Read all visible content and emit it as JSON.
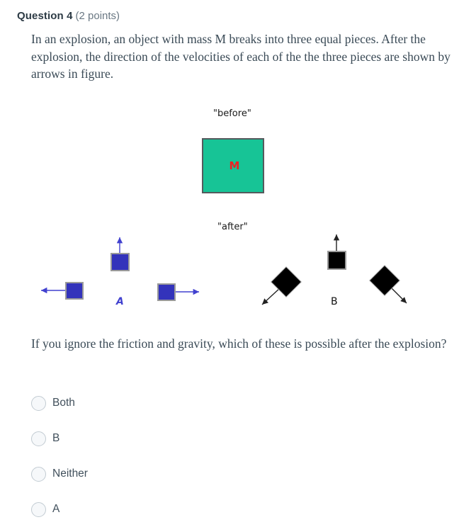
{
  "header": {
    "question_title": "Question 4",
    "points": "(2 points)"
  },
  "stem": {
    "text": "In an explosion, an object with mass M breaks into three equal pieces. After the explosion, the direction of the velocities of each of the the three pieces are shown by arrows in figure."
  },
  "figure": {
    "before_label": "\"before\"",
    "after_label": "\"after\"",
    "mass_label": "M",
    "diagram_a_letter": "A",
    "diagram_b_letter": "B",
    "colors": {
      "before_box_fill": "#17c496",
      "before_box_border": "#555a5d",
      "mass_text": "#ee2222",
      "diagram_a_square_fill": "#3333bb",
      "diagram_a_square_border": "#9a9a9a",
      "diagram_a_arrow": "#4141cf",
      "diagram_b_square_fill": "#000000",
      "diagram_b_square_border": "#9a9a9a",
      "diagram_b_arrow": "#333333"
    }
  },
  "prompt": {
    "text": "If you ignore the friction and gravity, which of these is possible after the explosion?"
  },
  "answers": {
    "options": [
      {
        "label": "Both",
        "selected": false
      },
      {
        "label": "B",
        "selected": false
      },
      {
        "label": "Neither",
        "selected": false
      },
      {
        "label": "A",
        "selected": false
      }
    ]
  }
}
